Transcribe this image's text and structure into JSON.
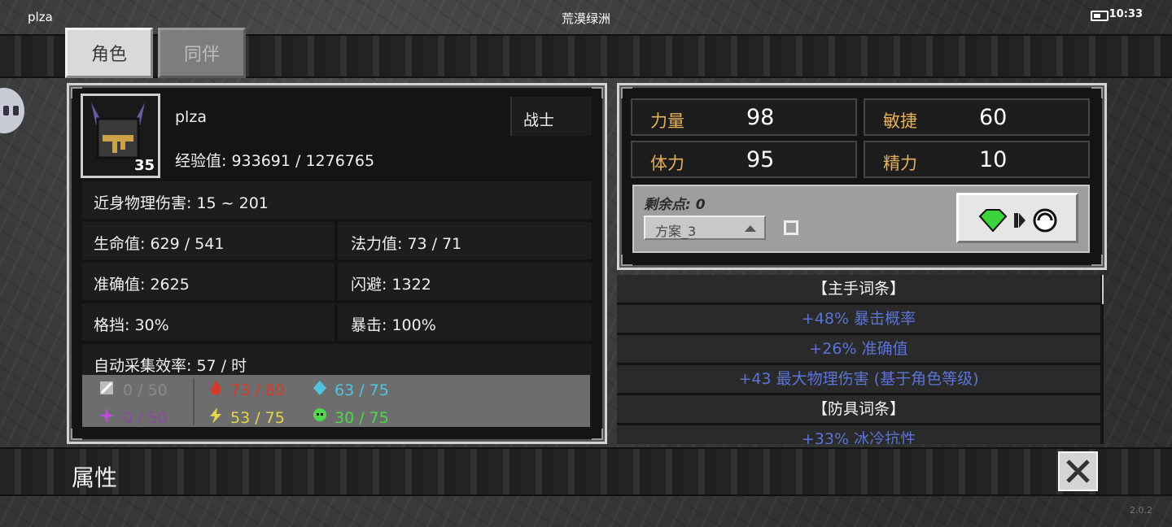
{
  "status_bar": {
    "username": "plza",
    "title": "荒漠绿洲",
    "time": "10:33"
  },
  "tabs": [
    {
      "label": "角色",
      "active": true
    },
    {
      "label": "同伴",
      "active": false
    }
  ],
  "character": {
    "name": "plza",
    "class": "战士",
    "level": "35",
    "experience": "经验值: 933691 / 1276765",
    "melee_damage": "近身物理伤害: 15 ~ 201",
    "hp": "生命值: 629 / 541",
    "mp": "法力值: 73 / 71",
    "accuracy": "准确值: 2625",
    "dodge": "闪避: 1322",
    "block": "格挡: 30%",
    "crit": "暴击: 100%",
    "gather_rate": "自动采集效率: 57 / 时"
  },
  "resistances": [
    {
      "icon": "sword-icon",
      "value": "0 / 50",
      "color": "#8a8a8a"
    },
    {
      "icon": "fire-icon",
      "value": "73 / 80",
      "color": "#d63a2a"
    },
    {
      "icon": "ice-crystal-icon",
      "value": "63 / 75",
      "color": "#4fc3e0"
    },
    {
      "icon": "arcane-burst-icon",
      "value": "0 / 50",
      "color": "#8a4a9e"
    },
    {
      "icon": "lightning-icon",
      "value": "53 / 75",
      "color": "#e6d64a"
    },
    {
      "icon": "poison-skull-icon",
      "value": "30 / 75",
      "color": "#4ed94a"
    }
  ],
  "attributes": [
    {
      "label": "力量",
      "value": "98"
    },
    {
      "label": "敏捷",
      "value": "60"
    },
    {
      "label": "体力",
      "value": "95"
    },
    {
      "label": "精力",
      "value": "10"
    }
  ],
  "points": {
    "remaining": "剩余点: 0",
    "plan": "方案_3"
  },
  "affixes": [
    {
      "text": "【主手词条】",
      "kind": "header"
    },
    {
      "text": "+48% 暴击概率",
      "kind": "stat"
    },
    {
      "text": "+26% 准确值",
      "kind": "stat"
    },
    {
      "text": "+43 最大物理伤害 (基于角色等级)",
      "kind": "stat"
    },
    {
      "text": "【防具词条】",
      "kind": "header"
    },
    {
      "text": "+33% 冰冷抗性",
      "kind": "stat"
    }
  ],
  "page_title": "属性",
  "version": "2.0.2",
  "colors": {
    "accent_gold": "#e4b05a",
    "affix_blue": "#5b74d6",
    "panel_bg": "#141414"
  }
}
